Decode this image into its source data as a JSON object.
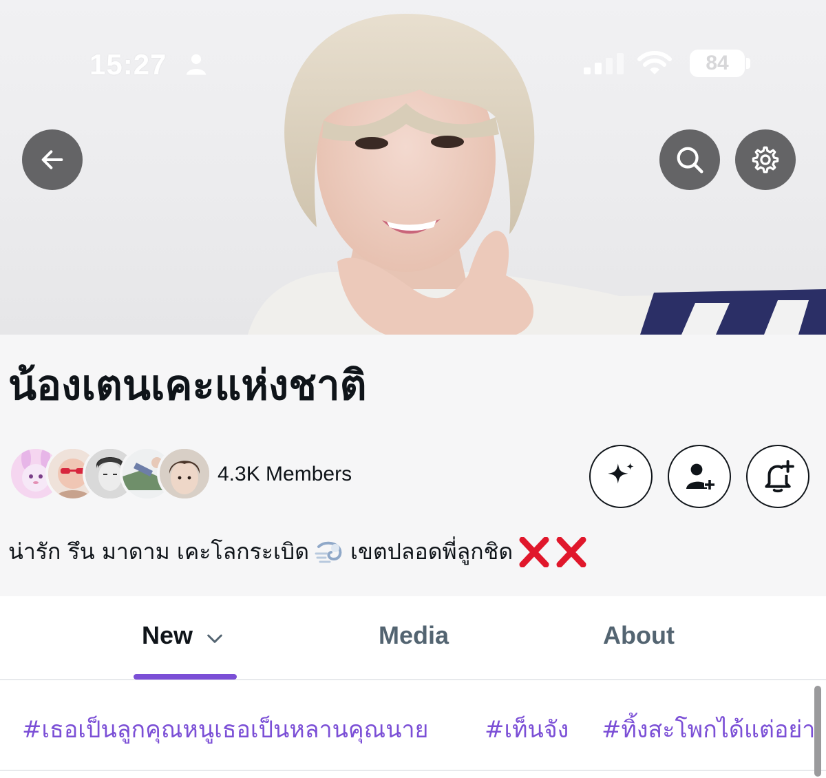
{
  "status_bar": {
    "time": "15:27",
    "battery": "84",
    "icons": [
      "person-icon",
      "cellular-signal-icon",
      "wifi-icon",
      "battery-icon"
    ]
  },
  "cover": {
    "alt": "Community cover photo",
    "buttons": [
      "back-arrow-icon",
      "search-icon",
      "settings-gear-icon"
    ]
  },
  "community": {
    "name": "น้องเตนเคะแห่งชาติ",
    "members": "4.3K Members",
    "member_avatars": 5,
    "bio_part1": "น่ารัก รึน มาดาม เคะโลกระเบิด",
    "bio_part2": "เขตปลอดพี่ลูกชิด",
    "bio_emojis": [
      "dash-emoji",
      "cross-mark-emoji",
      "cross-mark-emoji"
    ],
    "action_icons": [
      "sparkle-icon",
      "invite-member-icon",
      "notification-add-icon"
    ]
  },
  "tabs": [
    {
      "label": "New",
      "active": true
    },
    {
      "label": "Media",
      "active": false
    },
    {
      "label": "About",
      "active": false
    }
  ],
  "hashtags": [
    "#เธอเป็นลูกคุณหนูเธอเป็นหลานคุณนาย",
    "#เท็นจัง",
    "#ทิ้งสะโพกได้แต่อย่า"
  ],
  "colors": {
    "accent": "#7b4fd6",
    "text_primary": "#0f1419",
    "text_secondary": "#536471",
    "header_bg": "#f6f6f7"
  }
}
